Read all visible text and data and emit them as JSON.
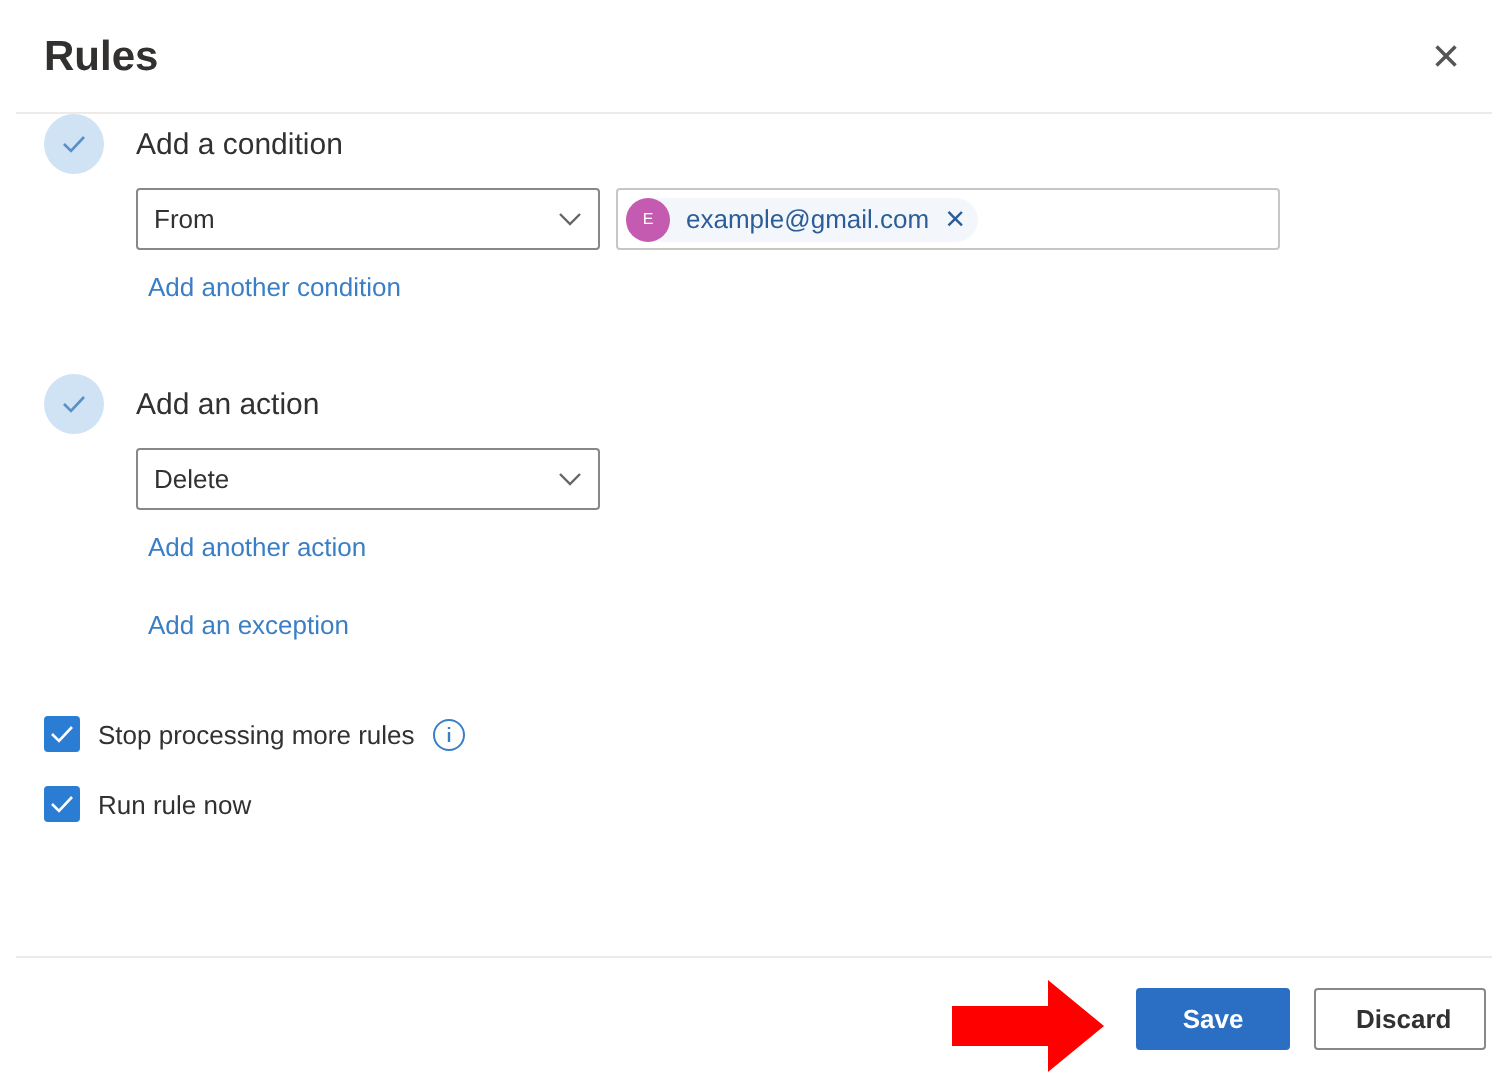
{
  "window": {
    "title": "Rules",
    "close": "×"
  },
  "sections": [
    {
      "heading": "Add a condition",
      "done": true,
      "dropdown": {
        "value": "From"
      },
      "recipients": [
        {
          "initial": "E",
          "color": "#c45bb0",
          "address": "example@gmail.com",
          "remove": "×"
        }
      ],
      "links": [
        "Add another condition"
      ]
    },
    {
      "heading": "Add an action",
      "done": true,
      "dropdown": {
        "value": "Delete"
      },
      "links": [
        "Add another action",
        "Add an exception"
      ]
    }
  ],
  "options": [
    {
      "label": "Stop processing more rules",
      "checked": true,
      "info": true
    },
    {
      "label": "Run rule now",
      "checked": true,
      "info": false
    }
  ],
  "buttons": [
    {
      "label": "Save",
      "kind": "primary"
    },
    {
      "label": "Discard",
      "kind": "secondary"
    }
  ]
}
